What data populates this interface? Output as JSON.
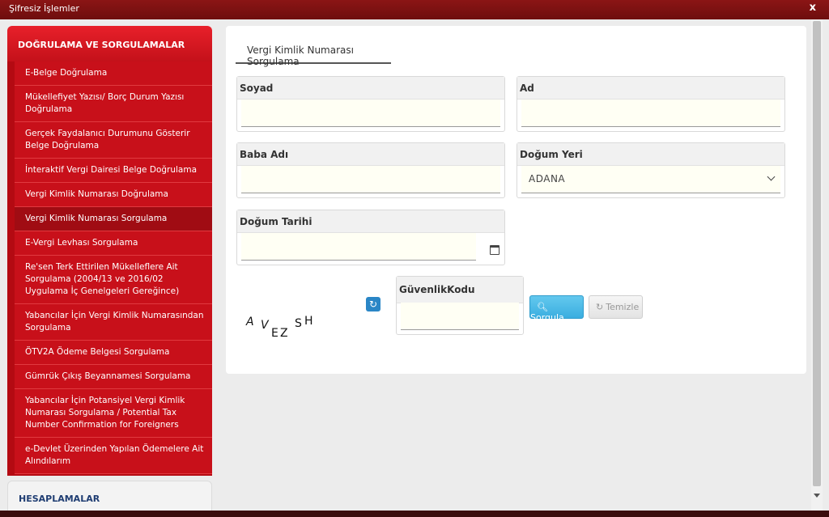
{
  "window": {
    "title": "Şifresiz İşlemler",
    "close": "x"
  },
  "sidebar": {
    "section1": "DOĞRULAMA VE SORGULAMALAR",
    "items": [
      {
        "label": "E-Belge Doğrulama"
      },
      {
        "label": "Mükellefiyet Yazısı/ Borç Durum Yazısı Doğrulama"
      },
      {
        "label": "Gerçek Faydalanıcı Durumunu Gösterir Belge Doğrulama"
      },
      {
        "label": "İnteraktif Vergi Dairesi Belge Doğrulama"
      },
      {
        "label": "Vergi Kimlik Numarası Doğrulama"
      },
      {
        "label": "Vergi Kimlik Numarası Sorgulama"
      },
      {
        "label": "E-Vergi Levhası Sorgulama"
      },
      {
        "label": "Re'sen Terk Ettirilen Mükelleflere Ait Sorgulama (2004/13 ve 2016/02 Uygulama İç Genelgeleri Gereğince)"
      },
      {
        "label": "Yabancılar İçin Vergi Kimlik Numarasından Sorgulama"
      },
      {
        "label": "ÖTV2A Ödeme Belgesi Sorgulama"
      },
      {
        "label": "Gümrük Çıkış Beyannamesi Sorgulama"
      },
      {
        "label": "Yabancılar İçin Potansiyel Vergi Kimlik Numarası Sorgulama / Potential Tax Number Confirmation for Foreigners"
      },
      {
        "label": "e-Devlet Üzerinden Yapılan Ödemelere Ait Alındılarım"
      }
    ],
    "section2": "HESAPLAMALAR"
  },
  "main": {
    "tab": "Vergi Kimlik Numarası Sorgulama",
    "fields": {
      "soyad": {
        "label": "Soyad",
        "value": ""
      },
      "ad": {
        "label": "Ad",
        "value": ""
      },
      "baba_adi": {
        "label": "Baba Adı",
        "value": ""
      },
      "dogum_yeri": {
        "label": "Doğum Yeri",
        "value": "ADANA"
      },
      "dogum_tarihi": {
        "label": "Doğum Tarihi",
        "value": ""
      },
      "guvenlik_kodu": {
        "label": "GüvenlikKodu",
        "value": ""
      }
    },
    "captcha": {
      "c1": "A",
      "c2": "V",
      "c3": "E",
      "c4": "Z",
      "c5": "S",
      "c6": "H"
    },
    "buttons": {
      "search": "Sorgula",
      "clear": "Temizle"
    }
  },
  "colors": {
    "accent_red": "#c8101a",
    "button_blue": "#3aaee0"
  }
}
